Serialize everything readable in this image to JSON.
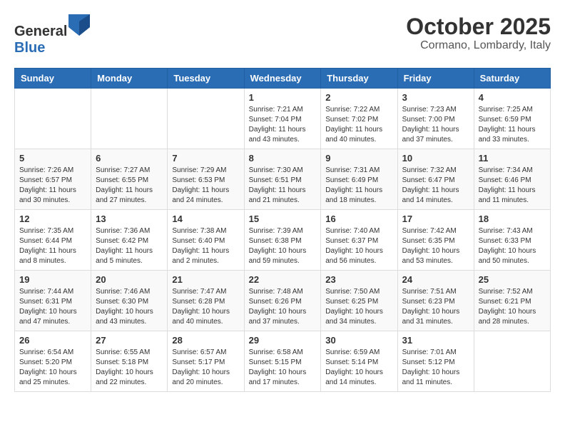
{
  "logo": {
    "text_general": "General",
    "text_blue": "Blue"
  },
  "title": "October 2025",
  "location": "Cormano, Lombardy, Italy",
  "days_of_week": [
    "Sunday",
    "Monday",
    "Tuesday",
    "Wednesday",
    "Thursday",
    "Friday",
    "Saturday"
  ],
  "weeks": [
    [
      {
        "day": "",
        "info": ""
      },
      {
        "day": "",
        "info": ""
      },
      {
        "day": "",
        "info": ""
      },
      {
        "day": "1",
        "info": "Sunrise: 7:21 AM\nSunset: 7:04 PM\nDaylight: 11 hours and 43 minutes."
      },
      {
        "day": "2",
        "info": "Sunrise: 7:22 AM\nSunset: 7:02 PM\nDaylight: 11 hours and 40 minutes."
      },
      {
        "day": "3",
        "info": "Sunrise: 7:23 AM\nSunset: 7:00 PM\nDaylight: 11 hours and 37 minutes."
      },
      {
        "day": "4",
        "info": "Sunrise: 7:25 AM\nSunset: 6:59 PM\nDaylight: 11 hours and 33 minutes."
      }
    ],
    [
      {
        "day": "5",
        "info": "Sunrise: 7:26 AM\nSunset: 6:57 PM\nDaylight: 11 hours and 30 minutes."
      },
      {
        "day": "6",
        "info": "Sunrise: 7:27 AM\nSunset: 6:55 PM\nDaylight: 11 hours and 27 minutes."
      },
      {
        "day": "7",
        "info": "Sunrise: 7:29 AM\nSunset: 6:53 PM\nDaylight: 11 hours and 24 minutes."
      },
      {
        "day": "8",
        "info": "Sunrise: 7:30 AM\nSunset: 6:51 PM\nDaylight: 11 hours and 21 minutes."
      },
      {
        "day": "9",
        "info": "Sunrise: 7:31 AM\nSunset: 6:49 PM\nDaylight: 11 hours and 18 minutes."
      },
      {
        "day": "10",
        "info": "Sunrise: 7:32 AM\nSunset: 6:47 PM\nDaylight: 11 hours and 14 minutes."
      },
      {
        "day": "11",
        "info": "Sunrise: 7:34 AM\nSunset: 6:46 PM\nDaylight: 11 hours and 11 minutes."
      }
    ],
    [
      {
        "day": "12",
        "info": "Sunrise: 7:35 AM\nSunset: 6:44 PM\nDaylight: 11 hours and 8 minutes."
      },
      {
        "day": "13",
        "info": "Sunrise: 7:36 AM\nSunset: 6:42 PM\nDaylight: 11 hours and 5 minutes."
      },
      {
        "day": "14",
        "info": "Sunrise: 7:38 AM\nSunset: 6:40 PM\nDaylight: 11 hours and 2 minutes."
      },
      {
        "day": "15",
        "info": "Sunrise: 7:39 AM\nSunset: 6:38 PM\nDaylight: 10 hours and 59 minutes."
      },
      {
        "day": "16",
        "info": "Sunrise: 7:40 AM\nSunset: 6:37 PM\nDaylight: 10 hours and 56 minutes."
      },
      {
        "day": "17",
        "info": "Sunrise: 7:42 AM\nSunset: 6:35 PM\nDaylight: 10 hours and 53 minutes."
      },
      {
        "day": "18",
        "info": "Sunrise: 7:43 AM\nSunset: 6:33 PM\nDaylight: 10 hours and 50 minutes."
      }
    ],
    [
      {
        "day": "19",
        "info": "Sunrise: 7:44 AM\nSunset: 6:31 PM\nDaylight: 10 hours and 47 minutes."
      },
      {
        "day": "20",
        "info": "Sunrise: 7:46 AM\nSunset: 6:30 PM\nDaylight: 10 hours and 43 minutes."
      },
      {
        "day": "21",
        "info": "Sunrise: 7:47 AM\nSunset: 6:28 PM\nDaylight: 10 hours and 40 minutes."
      },
      {
        "day": "22",
        "info": "Sunrise: 7:48 AM\nSunset: 6:26 PM\nDaylight: 10 hours and 37 minutes."
      },
      {
        "day": "23",
        "info": "Sunrise: 7:50 AM\nSunset: 6:25 PM\nDaylight: 10 hours and 34 minutes."
      },
      {
        "day": "24",
        "info": "Sunrise: 7:51 AM\nSunset: 6:23 PM\nDaylight: 10 hours and 31 minutes."
      },
      {
        "day": "25",
        "info": "Sunrise: 7:52 AM\nSunset: 6:21 PM\nDaylight: 10 hours and 28 minutes."
      }
    ],
    [
      {
        "day": "26",
        "info": "Sunrise: 6:54 AM\nSunset: 5:20 PM\nDaylight: 10 hours and 25 minutes."
      },
      {
        "day": "27",
        "info": "Sunrise: 6:55 AM\nSunset: 5:18 PM\nDaylight: 10 hours and 22 minutes."
      },
      {
        "day": "28",
        "info": "Sunrise: 6:57 AM\nSunset: 5:17 PM\nDaylight: 10 hours and 20 minutes."
      },
      {
        "day": "29",
        "info": "Sunrise: 6:58 AM\nSunset: 5:15 PM\nDaylight: 10 hours and 17 minutes."
      },
      {
        "day": "30",
        "info": "Sunrise: 6:59 AM\nSunset: 5:14 PM\nDaylight: 10 hours and 14 minutes."
      },
      {
        "day": "31",
        "info": "Sunrise: 7:01 AM\nSunset: 5:12 PM\nDaylight: 10 hours and 11 minutes."
      },
      {
        "day": "",
        "info": ""
      }
    ]
  ]
}
